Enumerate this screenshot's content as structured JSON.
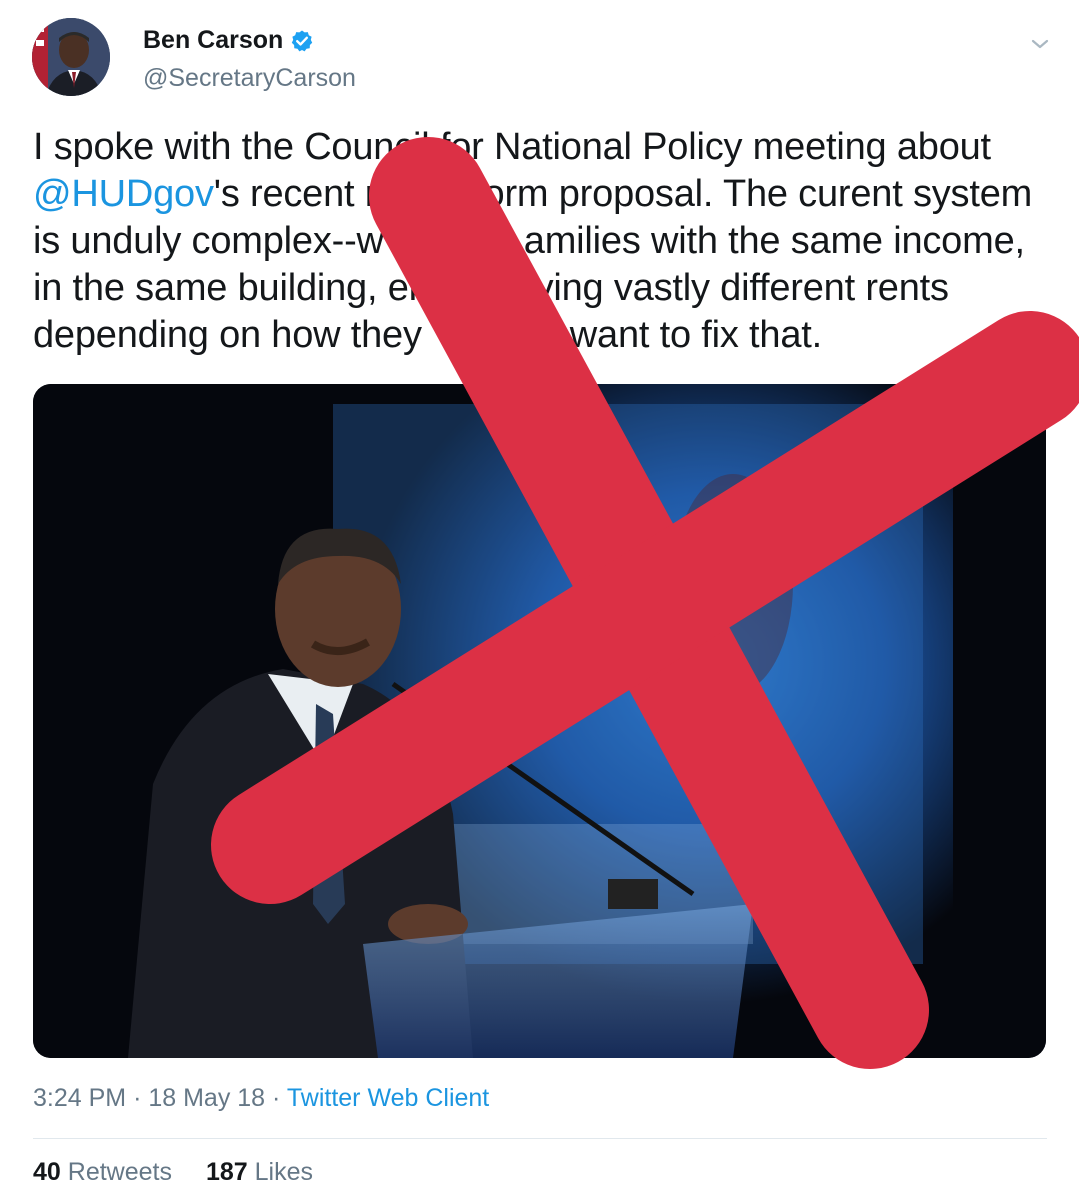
{
  "user": {
    "display_name": "Ben Carson",
    "handle": "@SecretaryCarson",
    "verified": true
  },
  "tweet": {
    "text_part1": "I spoke with the Council for National Policy meeting about ",
    "mention": "@HUDgov",
    "text_part2": "'s recent rent reform proposal. The curent system is unduly complex--w",
    "text_part3": "amilies with the same income, in the same building, en",
    "text_part4": "ving vastly different rents depending on how they",
    "text_part5": "want to fix that."
  },
  "meta": {
    "time": "3:24 PM",
    "separator": "·",
    "date": "18 May 18",
    "source": "Twitter Web Client"
  },
  "stats": {
    "retweets_count": "40",
    "retweets_label": "Retweets",
    "likes_count": "187",
    "likes_label": "Likes"
  },
  "icons": {
    "verified": "verified-badge-icon",
    "menu": "chevron-down-icon"
  },
  "colors": {
    "link": "#1b95e0",
    "verified": "#1da1f2",
    "overlay_x": "#dc3045",
    "secondary_text": "#657786"
  }
}
